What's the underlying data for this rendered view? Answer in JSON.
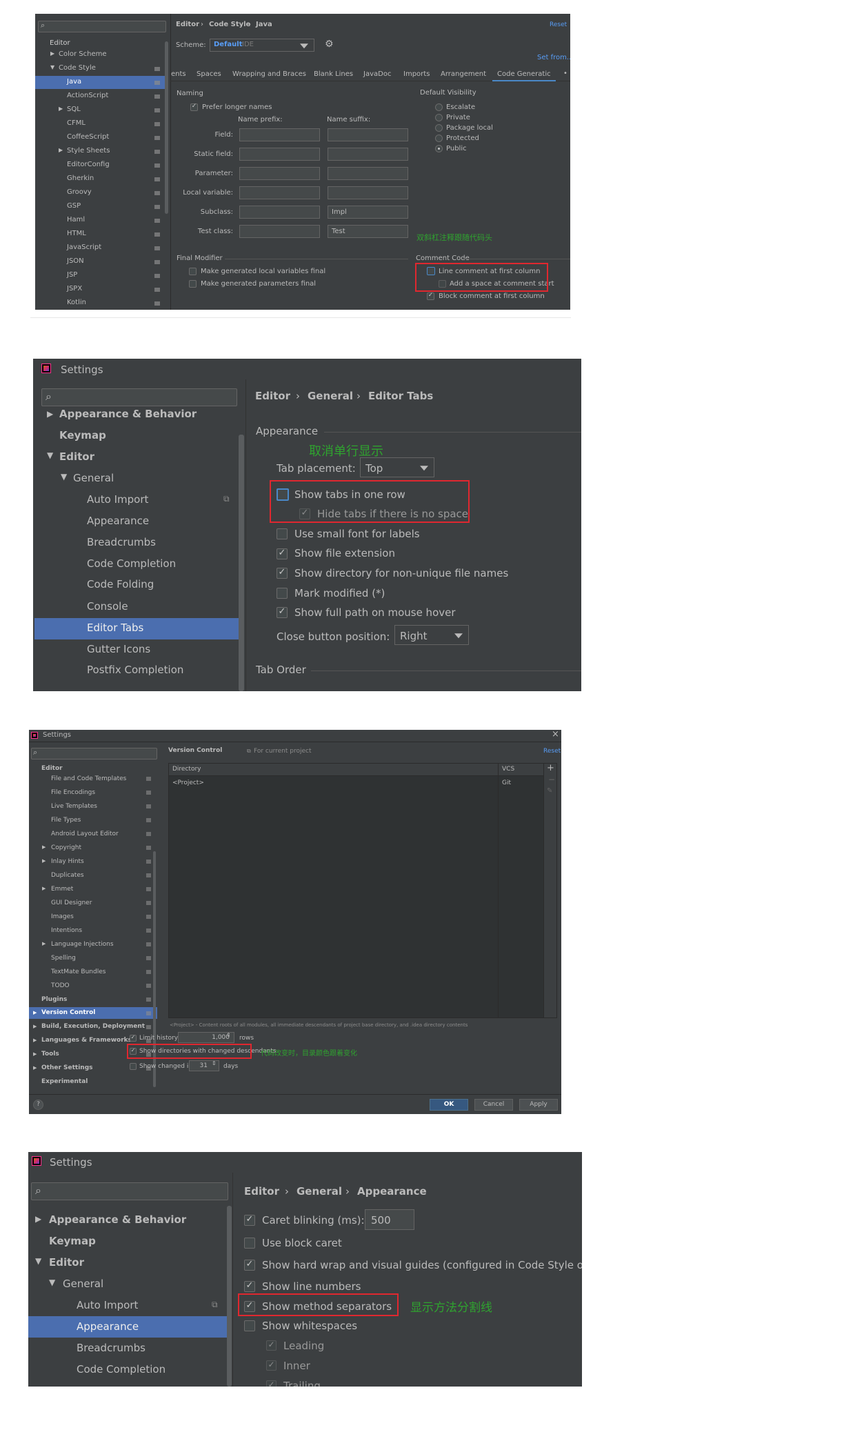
{
  "panel1": {
    "breadcrumb": [
      "Editor",
      "Code Style",
      "Java"
    ],
    "reset_label": "Reset",
    "scheme_label": "Scheme:",
    "scheme_name": "Default",
    "scheme_ide": "IDE",
    "set_from_label": "Set from...",
    "sidebar": {
      "editor": "Editor",
      "items": [
        "Color Scheme",
        "Code Style",
        "Java",
        "ActionScript",
        "SQL",
        "CFML",
        "CoffeeScript",
        "Style Sheets",
        "EditorConfig",
        "Gherkin",
        "Groovy",
        "GSP",
        "Haml",
        "HTML",
        "JavaScript",
        "JSON",
        "JSP",
        "JSPX",
        "Kotlin"
      ]
    },
    "tabs": [
      "ents",
      "Spaces",
      "Wrapping and Braces",
      "Blank Lines",
      "JavaDoc",
      "Imports",
      "Arrangement",
      "Code Generatic"
    ],
    "naming_label": "Naming",
    "prefer_longer": "Prefer longer names",
    "name_prefix": "Name prefix:",
    "name_suffix": "Name suffix:",
    "rows": [
      {
        "label": "Field:",
        "prefix": "",
        "suffix": ""
      },
      {
        "label": "Static field:",
        "prefix": "",
        "suffix": ""
      },
      {
        "label": "Parameter:",
        "prefix": "",
        "suffix": ""
      },
      {
        "label": "Local variable:",
        "prefix": "",
        "suffix": ""
      },
      {
        "label": "Subclass:",
        "prefix": "",
        "suffix": "Impl"
      },
      {
        "label": "Test class:",
        "prefix": "",
        "suffix": "Test"
      }
    ],
    "default_visibility": "Default Visibility",
    "visibility": [
      "Escalate",
      "Private",
      "Package local",
      "Protected",
      "Public"
    ],
    "annotation": "双斜杠注释跟随代码头",
    "final_modifier": "Final Modifier",
    "final_items": [
      "Make generated local variables final",
      "Make generated parameters final"
    ],
    "comment_code": "Comment Code",
    "comment_items": [
      "Line comment at first column",
      "Add a space at comment start",
      "Block comment at first column"
    ]
  },
  "panel2": {
    "title": "Settings",
    "breadcrumb": [
      "Editor",
      "General",
      "Editor Tabs"
    ],
    "sidebar": [
      "Appearance & Behavior",
      "Keymap",
      "Editor",
      "General",
      "Auto Import",
      "Appearance",
      "Breadcrumbs",
      "Code Completion",
      "Code Folding",
      "Console",
      "Editor Tabs",
      "Gutter Icons",
      "Postfix Completion"
    ],
    "appearance": "Appearance",
    "annotation": "取消单行显示",
    "tab_placement_label": "Tab placement:",
    "tab_placement_value": "Top",
    "options": [
      "Show tabs in one row",
      "Hide tabs if there is no space",
      "Use small font for labels",
      "Show file extension",
      "Show directory for non-unique file names",
      "Mark modified (*)",
      "Show full path on mouse hover"
    ],
    "close_button_label": "Close button position:",
    "close_button_value": "Right",
    "tab_order": "Tab Order"
  },
  "panel3": {
    "title": "Settings",
    "close_glyph": "×",
    "sidebar": [
      "Editor",
      "File and Code Templates",
      "File Encodings",
      "Live Templates",
      "File Types",
      "Android Layout Editor",
      "Copyright",
      "Inlay Hints",
      "Duplicates",
      "Emmet",
      "GUI Designer",
      "Images",
      "Intentions",
      "Language Injections",
      "Spelling",
      "TextMate Bundles",
      "TODO",
      "Plugins",
      "Version Control",
      "Build, Execution, Deployment",
      "Languages & Frameworks",
      "Tools",
      "Other Settings",
      "Experimental"
    ],
    "header_title": "Version Control",
    "for_current_project": "For current project",
    "reset_label": "Reset",
    "table_headers": [
      "Directory",
      "VCS"
    ],
    "table_rows": [
      {
        "dir": "<Project>",
        "vcs": "Git"
      }
    ],
    "footnote": "<Project> - Content roots of all modules, all immediate descendants of project base directory, and .idea directory contents",
    "limit_history": "Limit history to:",
    "limit_value": "1,000",
    "rows_label": "rows",
    "show_dirs": "Show directories with changed descendants",
    "annotation": "代码改变时，目录颜色跟着变化",
    "show_changed": "Show changed in last",
    "days_value": "31",
    "days_label": "days",
    "buttons": {
      "ok": "OK",
      "cancel": "Cancel",
      "apply": "Apply"
    },
    "help": "?"
  },
  "panel4": {
    "title": "Settings",
    "breadcrumb": [
      "Editor",
      "General",
      "Appearance"
    ],
    "sidebar": [
      "Appearance & Behavior",
      "Keymap",
      "Editor",
      "General",
      "Auto Import",
      "Appearance",
      "Breadcrumbs",
      "Code Completion"
    ],
    "caret_blinking": "Caret blinking (ms):",
    "caret_value": "500",
    "options": [
      "Use block caret",
      "Show hard wrap and visual guides (configured in Code Style options)",
      "Show line numbers",
      "Show method separators",
      "Show whitespaces",
      "Leading",
      "Inner",
      "Trailing"
    ],
    "annotation": "显示方法分割线"
  }
}
